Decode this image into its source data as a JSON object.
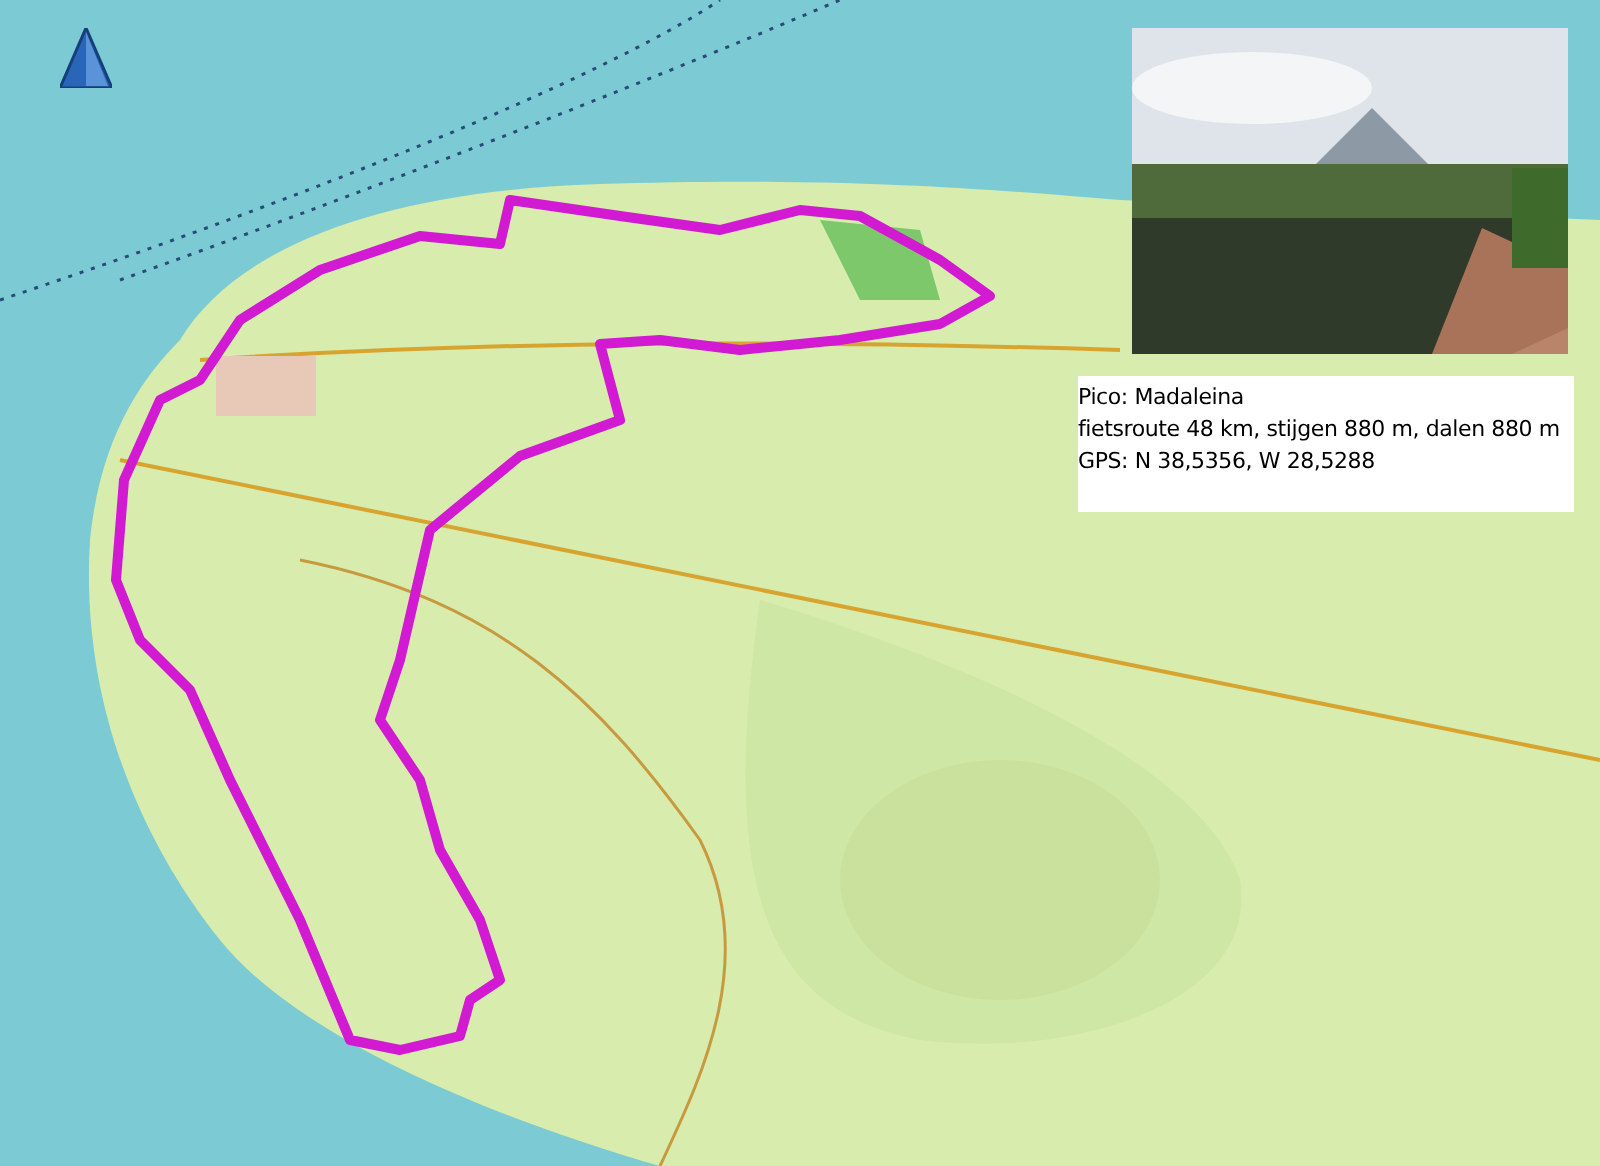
{
  "info_box": {
    "lines": [
      "Pico: Madaleina",
      "fietsroute 48 km, stijgen 880 m, dalen 880 m",
      "GPS: N 38,5356, W 28,5288"
    ]
  }
}
